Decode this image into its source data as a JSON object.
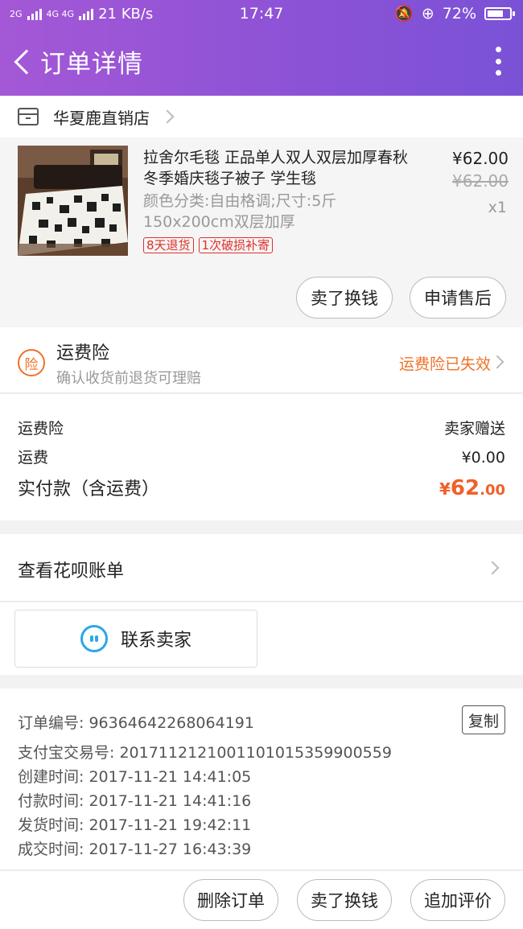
{
  "status_bar": {
    "network_left": "2G",
    "network_right": "4G 4G",
    "speed": "21 KB/s",
    "time": "17:47",
    "battery": "72%",
    "battery_level": 0.72
  },
  "header": {
    "title": "订单详情"
  },
  "store": {
    "name": "华夏鹿直销店"
  },
  "product": {
    "title": "拉舍尔毛毯 正品单人双人双层加厚春秋冬季婚庆毯子被子 学生毯",
    "sku": "颜色分类:自由格调;尺寸:5斤150x200cm双层加厚",
    "price": "¥62.00",
    "original_price": "¥62.00",
    "quantity": "x1",
    "tags": [
      "8天退货",
      "1次破损补寄"
    ],
    "buttons": {
      "sell": "卖了换钱",
      "after_sale": "申请售后"
    }
  },
  "insurance": {
    "icon": "险",
    "title": "运费险",
    "subtitle": "确认收货前退货可理赔",
    "status": "运费险已失效"
  },
  "costs": {
    "insurance_label": "运费险",
    "insurance_value": "卖家赠送",
    "shipping_label": "运费",
    "shipping_value": "¥0.00",
    "paid_label": "实付款（含运费）",
    "paid_currency": "¥",
    "paid_integer": "62",
    "paid_decimal": ".00"
  },
  "huabei": {
    "label": "查看花呗账单"
  },
  "contact": {
    "label": "联系卖家"
  },
  "order_info": {
    "order_no_label": "订单编号:",
    "order_no": "96364642268064191",
    "alipay_label": "支付宝交易号:",
    "alipay_no": "2017112121001101015359900559",
    "created_label": "创建时间:",
    "created": "2017-11-21 14:41:05",
    "paid_label": "付款时间:",
    "paid": "2017-11-21 14:41:16",
    "shipped_label": "发货时间:",
    "shipped": "2017-11-21 19:42:11",
    "completed_label": "成交时间:",
    "completed": "2017-11-27 16:43:39",
    "copy_button": "复制"
  },
  "bottom_bar": {
    "delete": "删除订单",
    "sell": "卖了换钱",
    "review": "追加评价"
  },
  "colors": {
    "header_start": "#a458d6",
    "header_end": "#7a52d6",
    "accent_orange": "#f0602a",
    "tag_red": "#e0302a",
    "contact_blue": "#2aa7ec"
  }
}
